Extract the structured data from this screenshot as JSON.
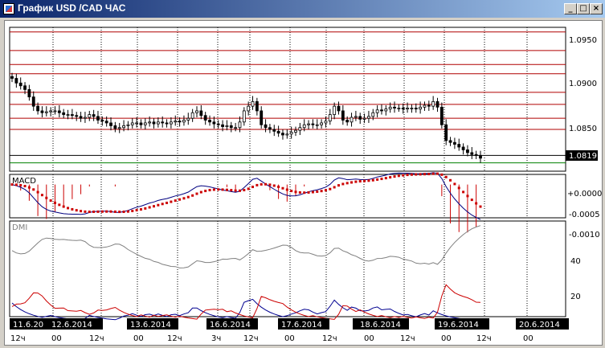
{
  "window": {
    "title": "График USD /CAD ЧАС",
    "buttons": [
      "_",
      "□",
      "×"
    ]
  },
  "chart_data": [
    {
      "type": "candlestick",
      "title": "",
      "price_ticks": [
        "1.0950",
        "1.0900",
        "1.0850"
      ],
      "price_tick_values": [
        1.095,
        1.09,
        1.085
      ],
      "ylim": [
        1.0805,
        1.096
      ],
      "last_price": "1.0819",
      "last_price_value": 1.0819,
      "horizontal_levels": [
        1.0955,
        1.0935,
        1.092,
        1.091,
        1.089,
        1.0877,
        1.0862,
        1.085,
        1.0822,
        1.0814
      ],
      "close": [
        1.0905,
        1.09,
        1.0897,
        1.0893,
        1.0885,
        1.0875,
        1.087,
        1.0868,
        1.0869,
        1.087,
        1.087,
        1.0868,
        1.0866,
        1.0866,
        1.0865,
        1.0864,
        1.0862,
        1.0863,
        1.0866,
        1.0864,
        1.086,
        1.0859,
        1.0857,
        1.0854,
        1.0851,
        1.0852,
        1.0854,
        1.0855,
        1.0857,
        1.0857,
        1.0855,
        1.0857,
        1.0858,
        1.0856,
        1.0858,
        1.0857,
        1.0856,
        1.0858,
        1.0859,
        1.0858,
        1.086,
        1.0862,
        1.0868,
        1.087,
        1.0865,
        1.086,
        1.0858,
        1.0856,
        1.0855,
        1.0853,
        1.0854,
        1.0852,
        1.0852,
        1.0858,
        1.087,
        1.0875,
        1.088,
        1.087,
        1.0855,
        1.0852,
        1.085,
        1.0848,
        1.0846,
        1.0844,
        1.0845,
        1.0847,
        1.0849,
        1.0852,
        1.0855,
        1.0856,
        1.0855,
        1.0855,
        1.0857,
        1.0859,
        1.0866,
        1.0875,
        1.087,
        1.086,
        1.0858,
        1.0863,
        1.0864,
        1.0861,
        1.0862,
        1.0864,
        1.0868,
        1.0871,
        1.087,
        1.0872,
        1.0874,
        1.0873,
        1.0873,
        1.0872,
        1.0873,
        1.0873,
        1.0872,
        1.0874,
        1.0876,
        1.0875,
        1.088,
        1.0874,
        1.0855,
        1.0838,
        1.0836,
        1.0834,
        1.0831,
        1.0828,
        1.0825,
        1.0823,
        1.0822,
        1.0819
      ]
    },
    {
      "type": "macd",
      "label": "MACD",
      "ticks": [
        "+0.0000",
        "-0.0005",
        "-0.0010"
      ],
      "tick_values": [
        0.0,
        -0.0005,
        -0.001
      ],
      "ylim": [
        -0.00115,
        0.00035
      ],
      "colors": {
        "macd_line": "#000080",
        "signal": "#cc0000",
        "histogram": "#cc0000"
      }
    },
    {
      "type": "dmi",
      "label": "DMI",
      "ticks": [
        "40",
        "20"
      ],
      "tick_values": [
        40,
        20
      ],
      "ylim": [
        10,
        52
      ],
      "colors": {
        "adx": "#808080",
        "plus_di": "#000090",
        "minus_di": "#cc0000"
      }
    }
  ],
  "time_axis": {
    "dates": [
      "11.6.20",
      "12.6.2014",
      "13.6.2014",
      "16.6.2014",
      "17.6.2014",
      "18.6.2014",
      "19.6.2014",
      "20.6.2014"
    ],
    "hours": [
      "12ч",
      "00",
      "12ч",
      "00",
      "12ч",
      "3ч",
      "12ч",
      "00",
      "12ч",
      "00",
      "12ч",
      "00",
      "12ч",
      "00"
    ]
  }
}
